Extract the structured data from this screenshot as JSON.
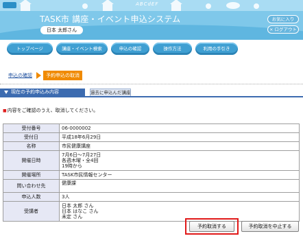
{
  "header": {
    "app_title": "TASK市 講座・イベント申込システム",
    "user_name": "日本 太郎さん",
    "favorites_button": "お気に入り",
    "logout_button": "× ログアウト",
    "decor_text": "ABCdEF",
    "colors": {
      "header_bg": "#7fc8ea",
      "nav_button": "#3f9fd2"
    }
  },
  "nav": {
    "items": [
      "トップページ",
      "講座・イベント検索",
      "申込の確認",
      "操作方法",
      "利用の手引き"
    ]
  },
  "breadcrumb": {
    "link": "申込の確認",
    "current": "予約申込の取消",
    "current_color": "#f08a00"
  },
  "tabs": {
    "active": "現在の予約申込み内容",
    "inactive": "過去に申込んだ講座"
  },
  "notice": {
    "mark": "■",
    "text": "内容をご確認のうえ、取消してください。"
  },
  "details": {
    "rows": [
      {
        "label": "受付番号",
        "value": "06-0000002"
      },
      {
        "label": "受付日",
        "value": "平成18年6月29日"
      },
      {
        "label": "名称",
        "value": "市民健康講座"
      },
      {
        "label": "開催日時",
        "value": "7月6日～7月27日\n各週木曜・全4回\n19時から"
      },
      {
        "label": "開催場所",
        "value": "TASK市民情報センター"
      },
      {
        "label": "問い合わせ先",
        "value": "健康課"
      },
      {
        "label": "申込人数",
        "value": "3人"
      },
      {
        "label": "受講者",
        "value": "日本 太郎 さん\n日本 はなこ さん\n未定 さん"
      }
    ]
  },
  "actions": {
    "cancel_reservation": "予約取消する",
    "abort_cancel": "予約取消を中止する"
  }
}
